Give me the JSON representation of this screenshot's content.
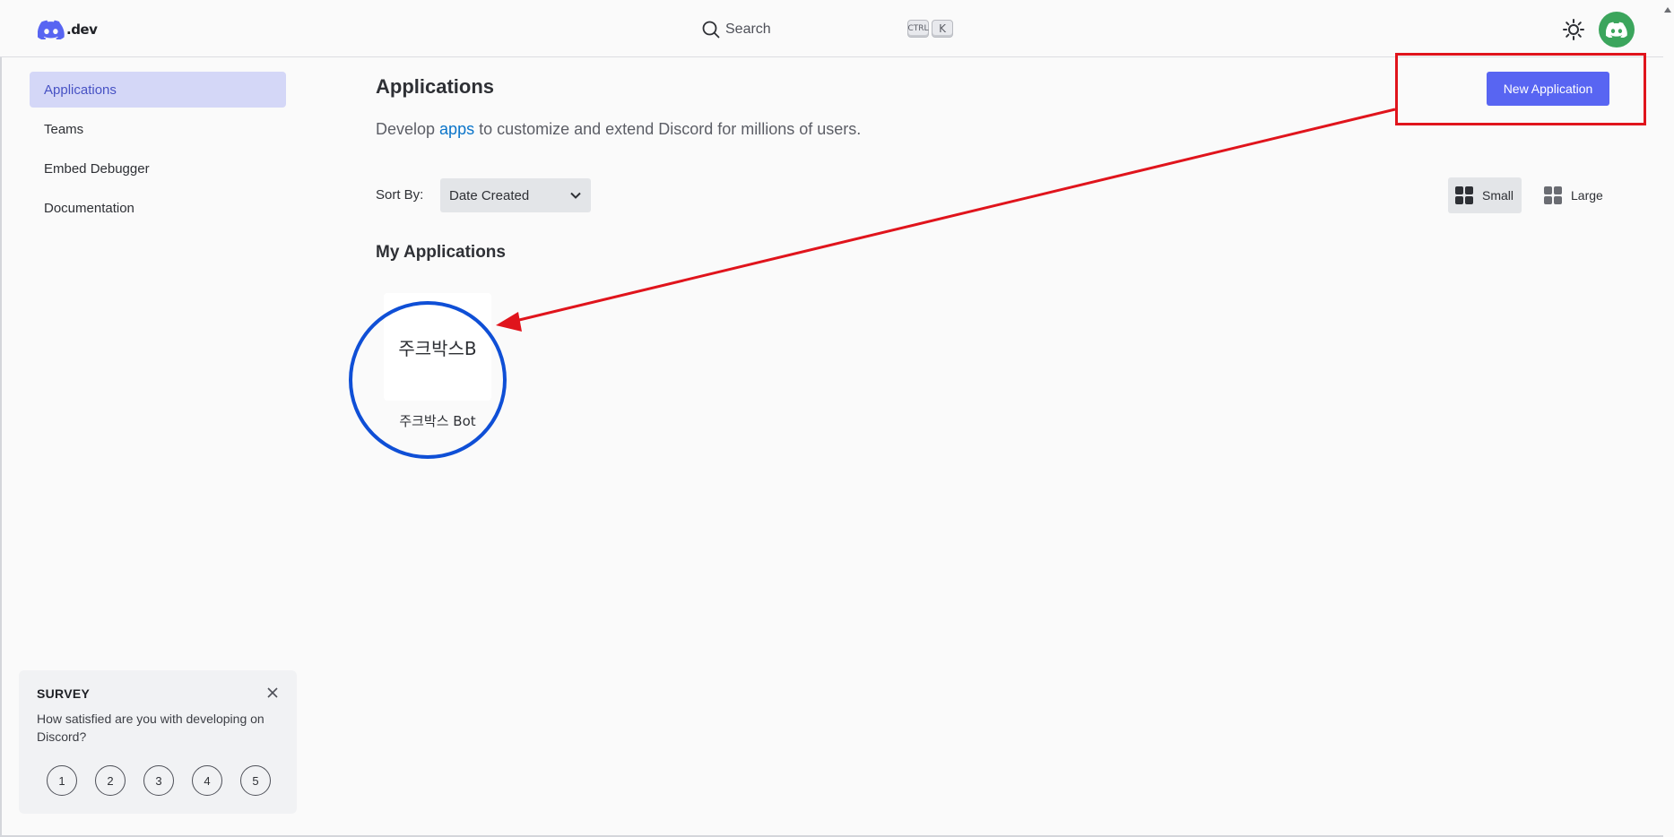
{
  "header": {
    "logo_text": ".dev",
    "search_label": "Search",
    "shortcut_ctrl": "CTRL",
    "shortcut_key": "K"
  },
  "sidebar": {
    "items": [
      {
        "label": "Applications",
        "active": true
      },
      {
        "label": "Teams"
      },
      {
        "label": "Embed Debugger"
      },
      {
        "label": "Documentation"
      }
    ]
  },
  "survey": {
    "title": "SURVEY",
    "question": "How satisfied are you with developing on Discord?",
    "ratings": [
      "1",
      "2",
      "3",
      "4",
      "5"
    ]
  },
  "main": {
    "title": "Applications",
    "subtitle_before": "Develop ",
    "subtitle_link": "apps",
    "subtitle_after": " to customize and extend Discord for millions of users.",
    "new_app_label": "New Application",
    "sort_label": "Sort By:",
    "sort_value": "Date Created",
    "view_small": "Small",
    "view_large": "Large",
    "section_title": "My Applications",
    "apps": [
      {
        "icon_text": "주크박스B",
        "name": "주크박스 Bot"
      }
    ]
  },
  "colors": {
    "brand": "#5865f2",
    "annotation_box": "#e0141c",
    "annotation_circle": "#0f4fd6",
    "avatar_bg": "#3ba55c"
  }
}
